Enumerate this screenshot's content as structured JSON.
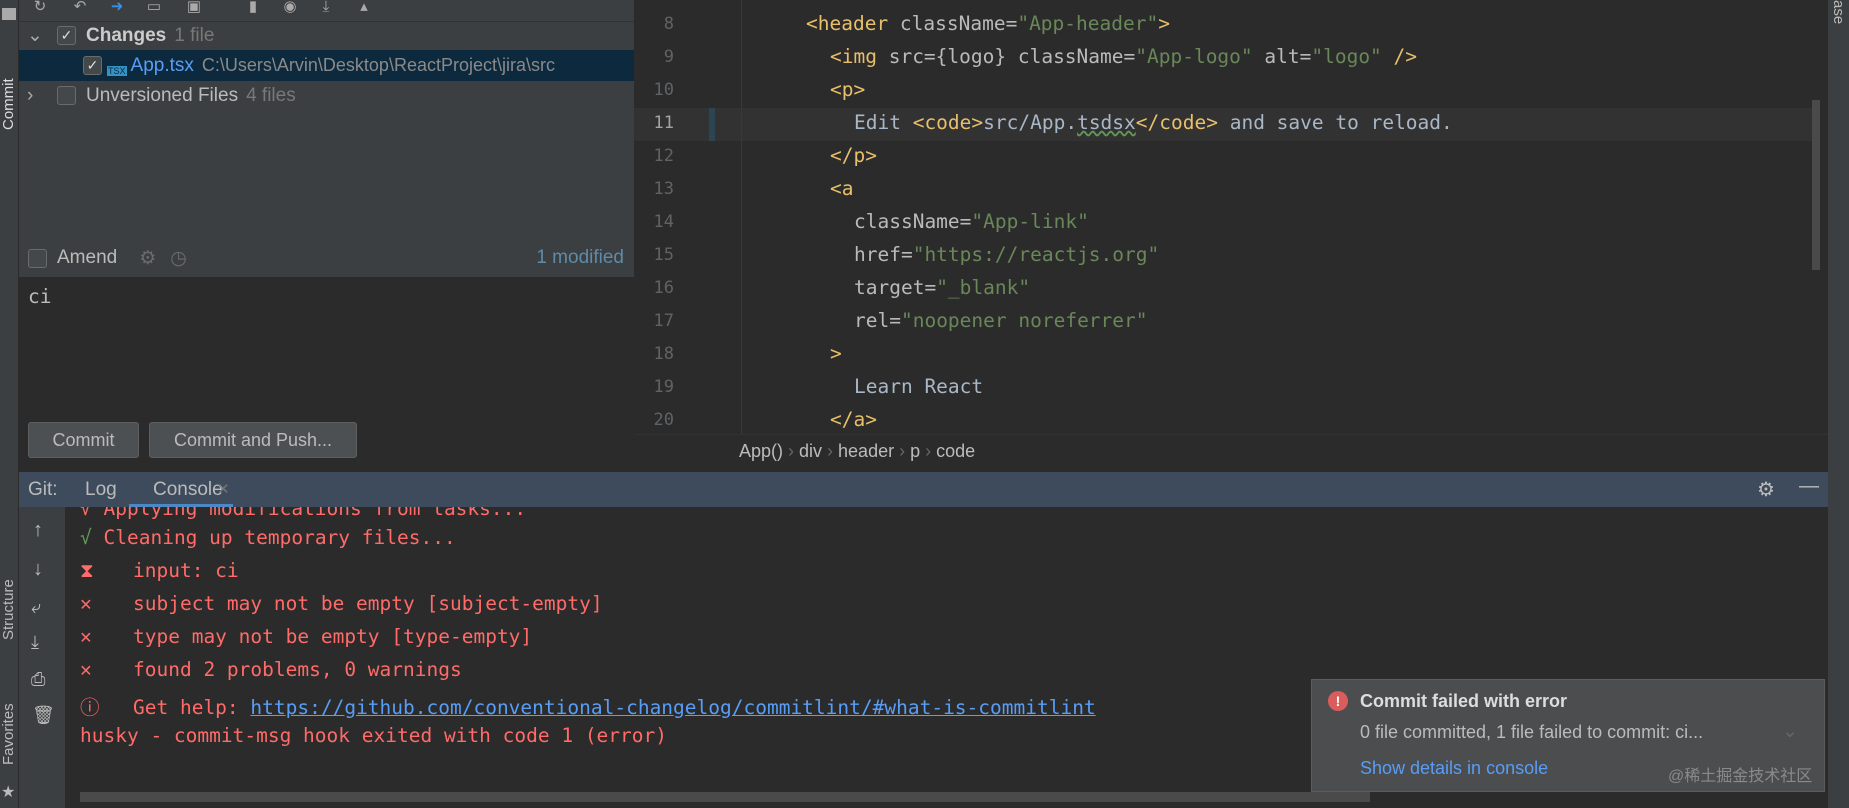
{
  "side_tabs": {
    "commit": "Commit",
    "structure": "Structure",
    "favorites": "Favorites",
    "database": "Database"
  },
  "commit_panel": {
    "changes_label": "Changes",
    "changes_count": "1 file",
    "file_name": "App.tsx",
    "file_path": "C:\\Users\\Arvin\\Desktop\\ReactProject\\jira\\src",
    "file_badge": "TSX",
    "unversioned_label": "Unversioned Files",
    "unversioned_count": "4 files",
    "amend_label": "Amend",
    "modified_label": "1 modified",
    "message": "ci",
    "commit_button": "Commit",
    "commit_push_button": "Commit and Push..."
  },
  "editor": {
    "lines": [
      {
        "n": "8",
        "html": "header"
      },
      {
        "n": "9"
      },
      {
        "n": "10"
      },
      {
        "n": "11"
      },
      {
        "n": "12"
      },
      {
        "n": "13"
      },
      {
        "n": "14"
      },
      {
        "n": "15"
      },
      {
        "n": "16"
      },
      {
        "n": "17"
      },
      {
        "n": "18"
      },
      {
        "n": "19"
      },
      {
        "n": "20"
      }
    ],
    "code": {
      "l8a": "<header",
      "l8b": " className=",
      "l8c": "\"App-header\"",
      "l8d": ">",
      "l9a": "<img",
      "l9b": " src={logo} className=",
      "l9c": "\"App-logo\"",
      "l9d": " alt=",
      "l9e": "\"logo\"",
      "l9f": " />",
      "l10": "<p>",
      "l11a": "Edit ",
      "l11b": "<code>",
      "l11c": "src/App.",
      "l11d": "tsdsx",
      "l11e": "</code>",
      "l11f": " and save to reload.",
      "l12": "</p>",
      "l13": "<a",
      "l14a": "className=",
      "l14b": "\"App-link\"",
      "l15a": "href=",
      "l15b": "\"https://reactjs.org\"",
      "l16a": "target=",
      "l16b": "\"_blank\"",
      "l17a": "rel=",
      "l17b": "\"noopener noreferrer\"",
      "l18": ">",
      "l19": "Learn React",
      "l20": "</a>"
    },
    "breadcrumb": [
      "App()",
      "div",
      "header",
      "p",
      "code"
    ]
  },
  "bottom": {
    "title": "Git:",
    "tabs": [
      "Log",
      "Console"
    ],
    "console": {
      "partial": "√ Applying modifications from tasks...",
      "check": "√",
      "cleaning": "Cleaning up temporary files...",
      "lines": [
        {
          "icon": "⧗",
          "text": "input: ci"
        },
        {
          "icon": "✕",
          "text": "subject may not be empty [subject-empty]"
        },
        {
          "icon": "✕",
          "text": "type may not be empty [type-empty]"
        },
        {
          "icon": "✕",
          "text": "found 2 problems, 0 warnings"
        }
      ],
      "help_icon": "ⓘ",
      "help_label": "Get help: ",
      "help_link": "https://github.com/conventional-changelog/commitlint/#what-is-commitlint",
      "husky": "husky - commit-msg hook exited with code 1 (error)"
    }
  },
  "notification": {
    "title": "Commit failed with error",
    "body": "0 file committed, 1 file failed to commit: ci...",
    "link": "Show details in console",
    "watermark": "@稀土掘金技术社区"
  },
  "colors": {
    "error": "#ff6b68",
    "link": "#589df6",
    "selection": "#0d293e",
    "header": "#3d4b5c"
  }
}
